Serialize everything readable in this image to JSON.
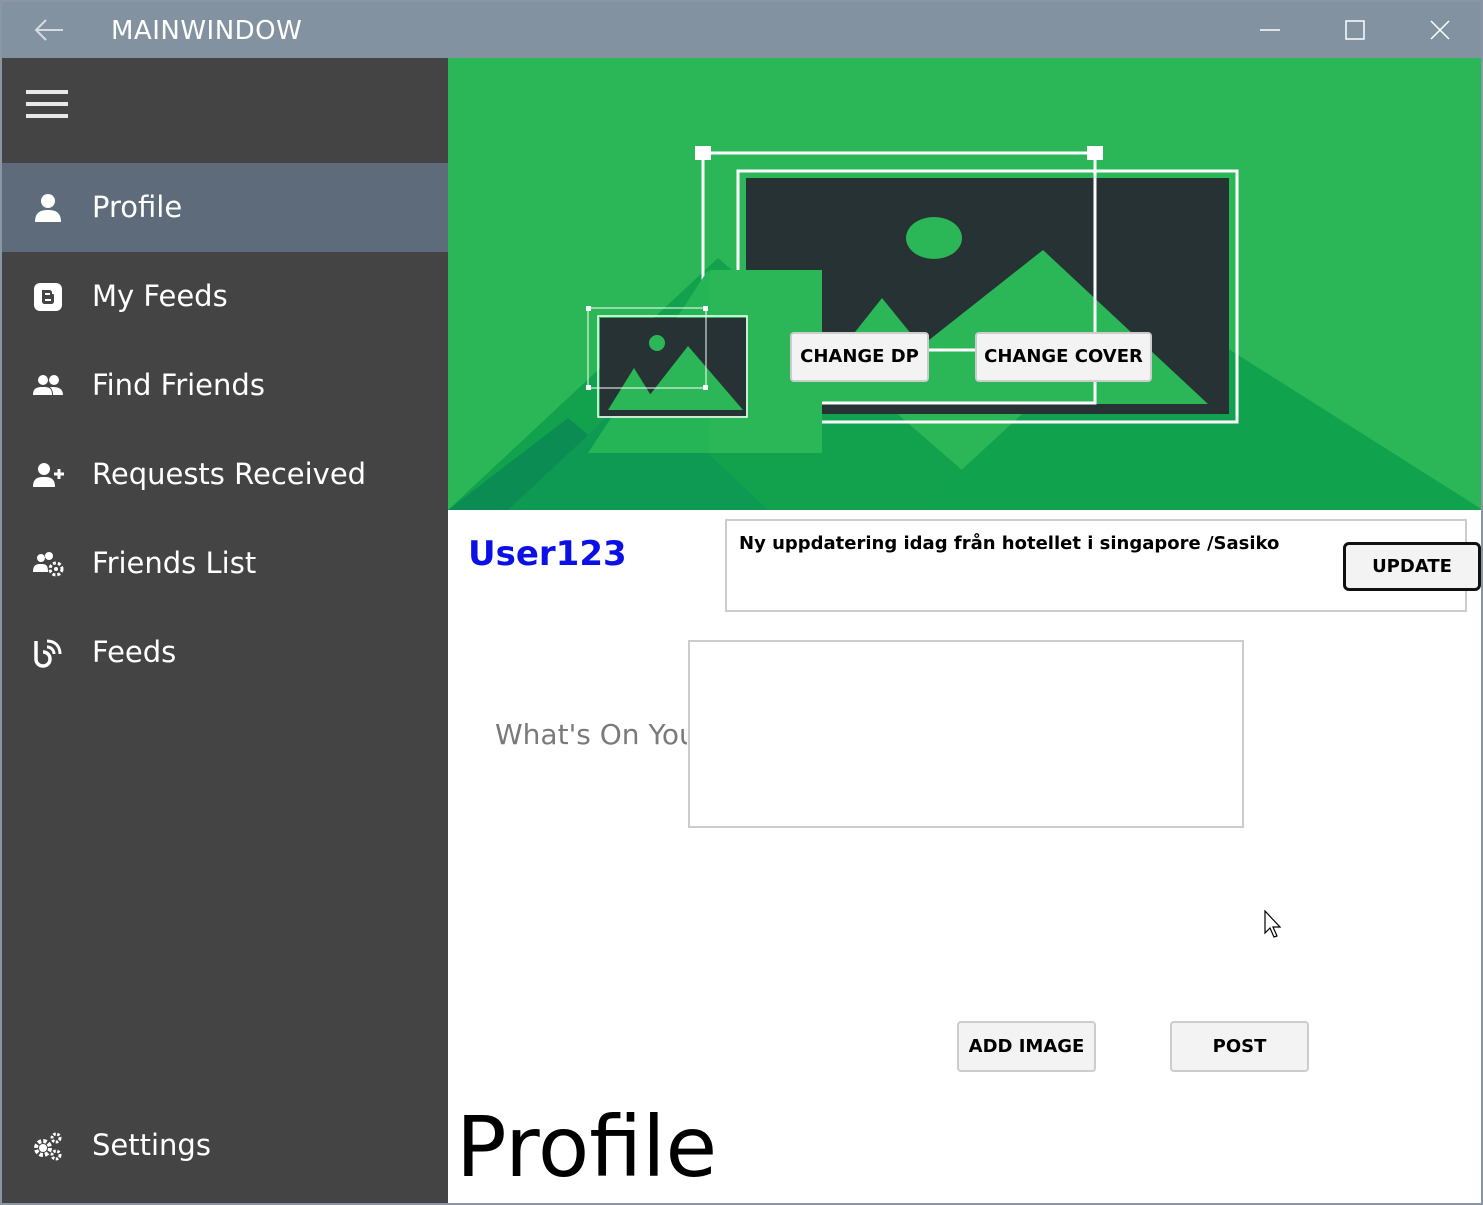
{
  "window": {
    "title": "MAINWINDOW"
  },
  "sidebar": {
    "items": [
      {
        "label": "Profile",
        "icon": "user-icon",
        "active": true
      },
      {
        "label": "My Feeds",
        "icon": "blogger-icon",
        "active": false
      },
      {
        "label": "Find Friends",
        "icon": "users-icon",
        "active": false
      },
      {
        "label": "Requests Received",
        "icon": "user-plus-icon",
        "active": false
      },
      {
        "label": "Friends List",
        "icon": "users-cog-icon",
        "active": false
      },
      {
        "label": "Feeds",
        "icon": "feed-icon",
        "active": false
      }
    ],
    "settings": {
      "label": "Settings",
      "icon": "cogs-icon"
    }
  },
  "profile": {
    "change_dp_label": "CHANGE DP",
    "change_cover_label": "CHANGE COVER",
    "username": "User123",
    "status_text": "Ny uppdatering idag från hotellet i singapore /Sasiko",
    "update_label": "UPDATE",
    "whats_on_label": "What's On Your Mind",
    "post_text": "",
    "add_image_label": "ADD IMAGE",
    "post_label": "POST",
    "page_heading": "Profile"
  },
  "colors": {
    "titlebar": "#8392a1",
    "sidebar": "#444444",
    "sidebar_active": "#5d6b7a",
    "cover_green": "#2bb757",
    "username_blue": "#0a10e6"
  }
}
